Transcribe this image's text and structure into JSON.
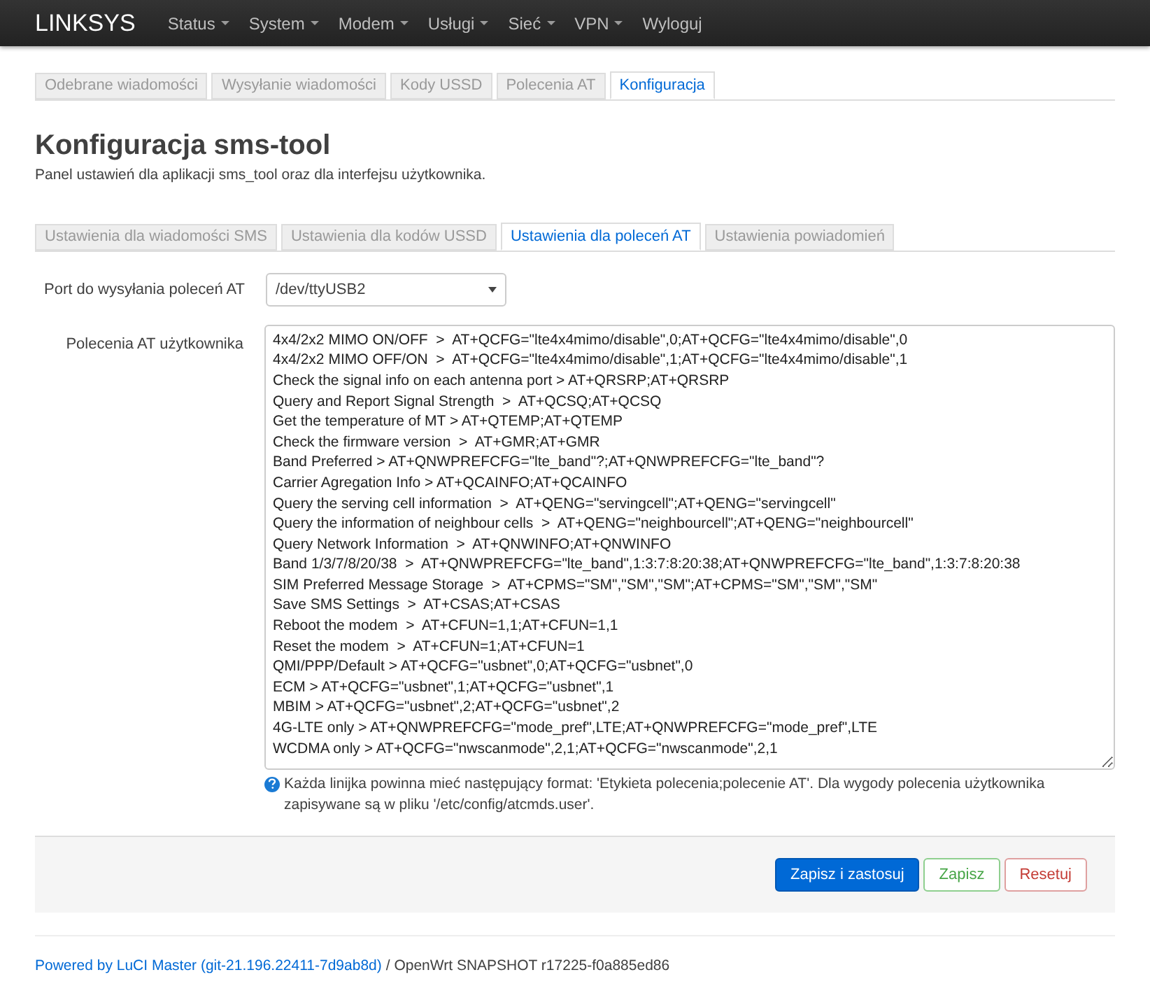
{
  "brand": "LINKSYS",
  "menu": [
    {
      "label": "Status",
      "dropdown": true
    },
    {
      "label": "System",
      "dropdown": true
    },
    {
      "label": "Modem",
      "dropdown": true
    },
    {
      "label": "Usługi",
      "dropdown": true
    },
    {
      "label": "Sieć",
      "dropdown": true
    },
    {
      "label": "VPN",
      "dropdown": true
    },
    {
      "label": "Wyloguj",
      "dropdown": false
    }
  ],
  "tabs": [
    {
      "label": "Odebrane wiadomości",
      "selected": false
    },
    {
      "label": "Wysyłanie wiadomości",
      "selected": false
    },
    {
      "label": "Kody USSD",
      "selected": false
    },
    {
      "label": "Polecenia AT",
      "selected": false
    },
    {
      "label": "Konfiguracja",
      "selected": true
    }
  ],
  "title": "Konfiguracja sms-tool",
  "description": "Panel ustawień dla aplikacji sms_tool oraz dla interfejsu użytkownika.",
  "subtabs": [
    {
      "label": "Ustawienia dla wiadomości SMS",
      "selected": false
    },
    {
      "label": "Ustawienia dla kodów USSD",
      "selected": false
    },
    {
      "label": "Ustawienia dla poleceń AT",
      "selected": true
    },
    {
      "label": "Ustawienia powiadomień",
      "selected": false
    }
  ],
  "port": {
    "label": "Port do wysyłania poleceń AT",
    "value": "/dev/ttyUSB2"
  },
  "commands": {
    "label": "Polecenia AT użytkownika",
    "lines": [
      "4x4/2x2 MIMO ON/OFF  >  AT+QCFG=\"lte4x4mimo/disable\",0;AT+QCFG=\"lte4x4mimo/disable\",0",
      "4x4/2x2 MIMO OFF/ON  >  AT+QCFG=\"lte4x4mimo/disable\",1;AT+QCFG=\"lte4x4mimo/disable\",1",
      "Check the signal info on each antenna port > AT+QRSRP;AT+QRSRP",
      "Query and Report Signal Strength  >  AT+QCSQ;AT+QCSQ",
      "Get the temperature of MT > AT+QTEMP;AT+QTEMP",
      "Check the firmware version  >  AT+GMR;AT+GMR",
      "Band Preferred > AT+QNWPREFCFG=\"lte_band\"?;AT+QNWPREFCFG=\"lte_band\"?",
      "Carrier Agregation Info > AT+QCAINFO;AT+QCAINFO",
      "Query the serving cell information  >  AT+QENG=\"servingcell\";AT+QENG=\"servingcell\"",
      "Query the information of neighbour cells  >  AT+QENG=\"neighbourcell\";AT+QENG=\"neighbourcell\"",
      "Query Network Information  >  AT+QNWINFO;AT+QNWINFO",
      "Band 1/3/7/8/20/38  >  AT+QNWPREFCFG=\"lte_band\",1:3:7:8:20:38;AT+QNWPREFCFG=\"lte_band\",1:3:7:8:20:38",
      "SIM Preferred Message Storage  >  AT+CPMS=\"SM\",\"SM\",\"SM\";AT+CPMS=\"SM\",\"SM\",\"SM\"",
      "Save SMS Settings  >  AT+CSAS;AT+CSAS",
      "Reboot the modem  >  AT+CFUN=1,1;AT+CFUN=1,1",
      "Reset the modem  >  AT+CFUN=1;AT+CFUN=1",
      "QMI/PPP/Default > AT+QCFG=\"usbnet\",0;AT+QCFG=\"usbnet\",0",
      "ECM > AT+QCFG=\"usbnet\",1;AT+QCFG=\"usbnet\",1",
      "MBIM > AT+QCFG=\"usbnet\",2;AT+QCFG=\"usbnet\",2",
      "4G-LTE only > AT+QNWPREFCFG=\"mode_pref\",LTE;AT+QNWPREFCFG=\"mode_pref\",LTE",
      "WCDMA only > AT+QCFG=\"nwscanmode\",2,1;AT+QCFG=\"nwscanmode\",2,1"
    ],
    "help": "Każda linijka powinna mieć następujący format: 'Etykieta polecenia;polecenie AT'. Dla wygody polecenia użytkownika zapisywane są w pliku '/etc/config/atcmds.user'."
  },
  "buttons": [
    {
      "label": "Zapisz i zastosuj",
      "kind": "primary"
    },
    {
      "label": "Zapisz",
      "kind": "positive"
    },
    {
      "label": "Resetuj",
      "kind": "negative"
    }
  ],
  "footer": {
    "link": "Powered by LuCI Master (git-21.196.22411-7d9ab8d)",
    "text": "/ OpenWrt SNAPSHOT r17225-f0a885ed86"
  }
}
